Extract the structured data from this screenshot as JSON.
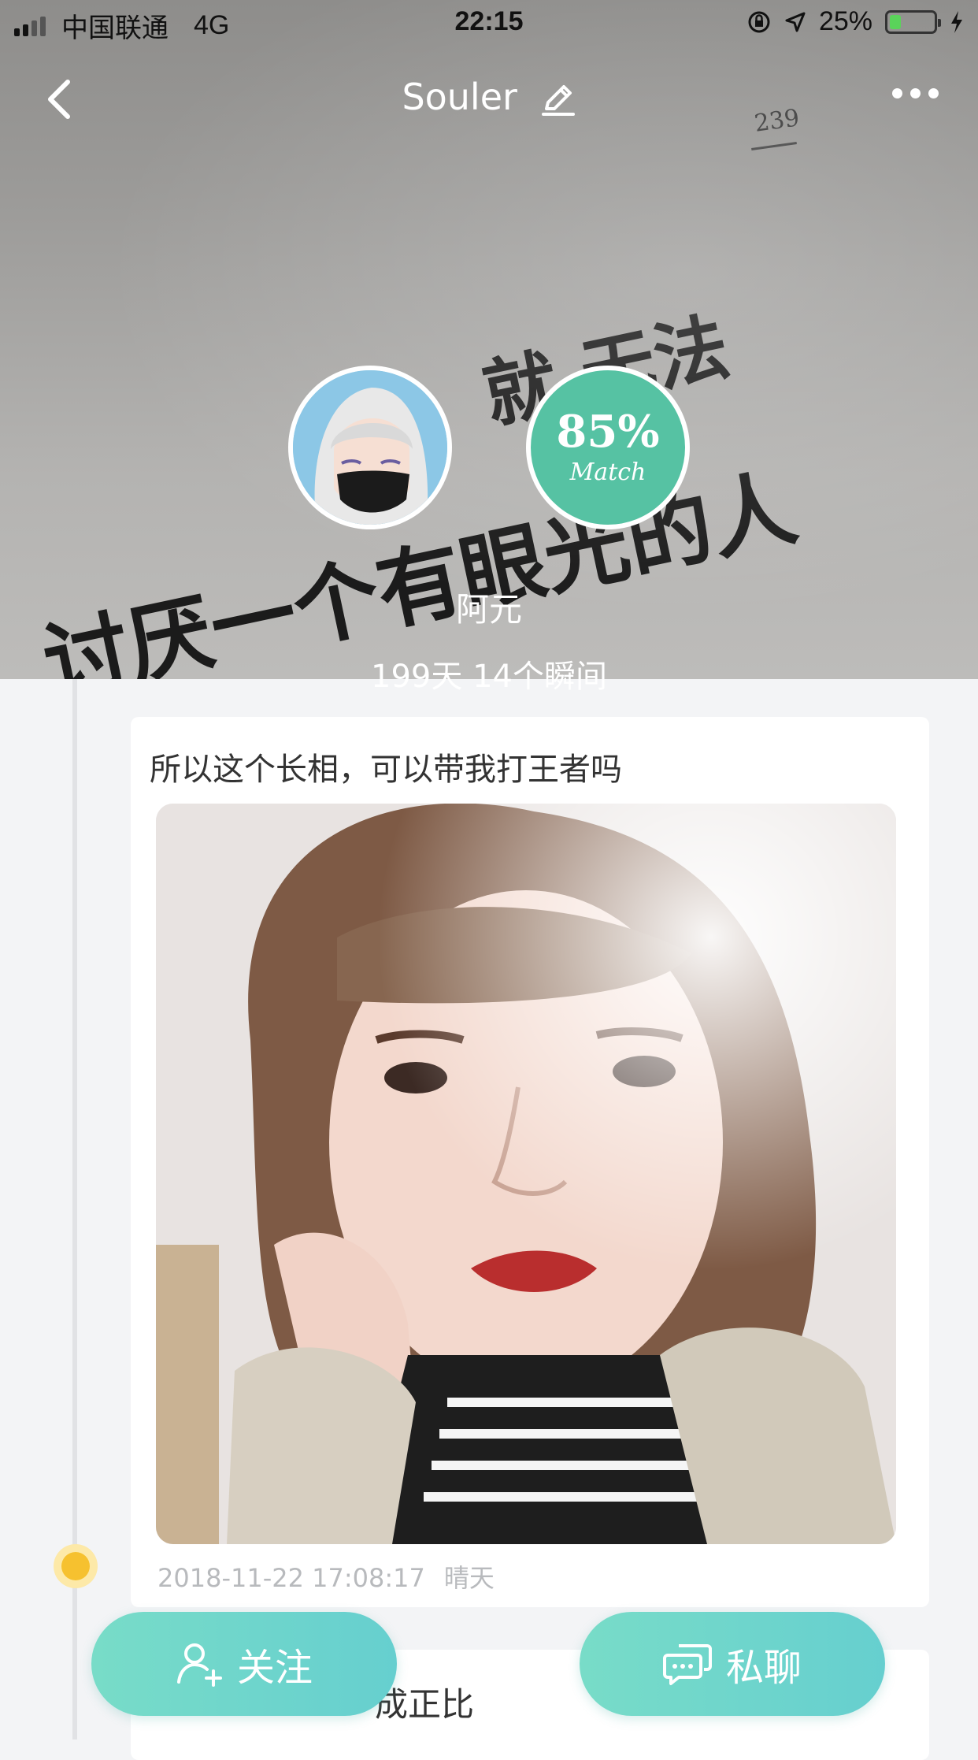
{
  "status_bar": {
    "carrier": "中国联通",
    "network": "4G",
    "time": "22:15",
    "battery": "25%",
    "battery_level": 0.25
  },
  "nav": {
    "title": "Souler"
  },
  "cover": {
    "page_number": "239",
    "line1": "就  无法",
    "line2": "讨厌一个有眼光的人"
  },
  "profile": {
    "match_percent": "85%",
    "match_label": "Match",
    "name": "阿元",
    "stats": "199天 14个瞬间"
  },
  "posts": [
    {
      "text": "所以这个长相，可以带我打王者吗",
      "date": "2018-11-22 17:08:17",
      "weather": "晴天"
    },
    {
      "text": "成正比"
    }
  ],
  "actions": {
    "follow_label": "关注",
    "chat_label": "私聊"
  },
  "colors": {
    "accent": "#5bc4a8",
    "button_gradient_start": "#78dcc8",
    "button_gradient_end": "#66cfcf",
    "meta_text": "#b8babd"
  }
}
